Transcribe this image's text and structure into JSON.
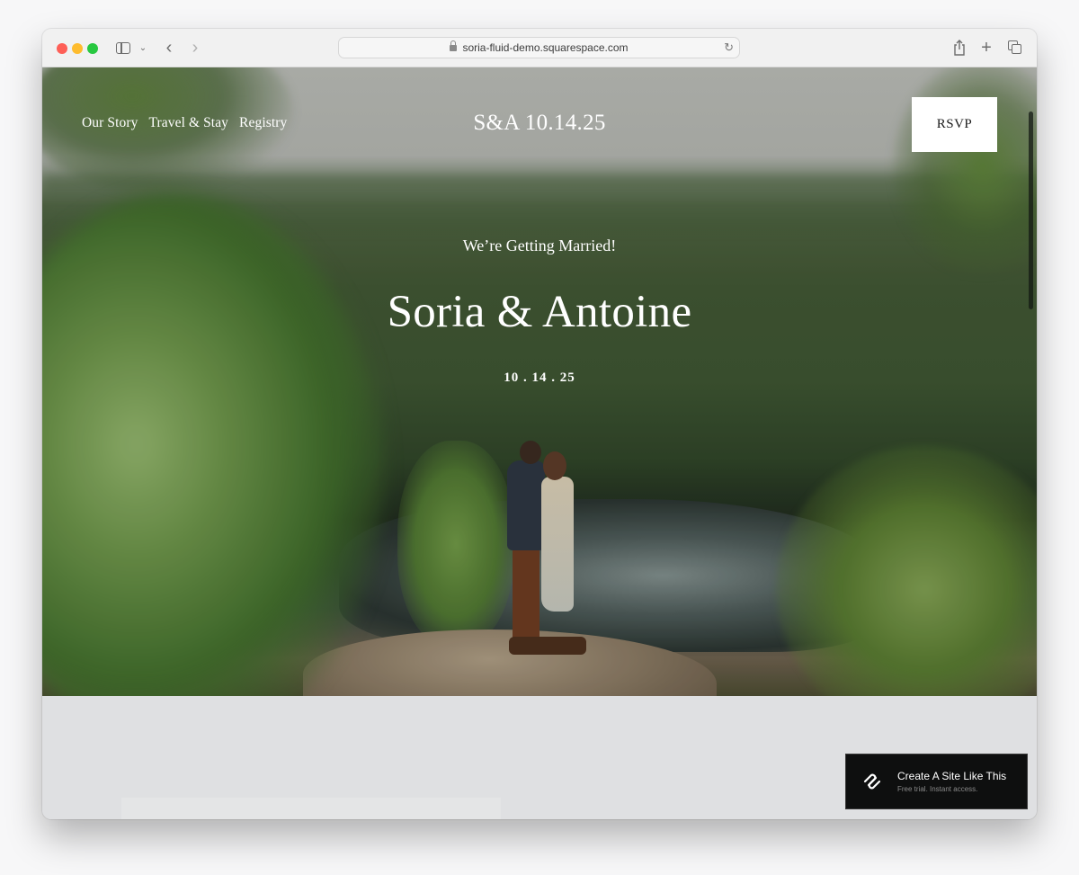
{
  "browser": {
    "url": "soria-fluid-demo.squarespace.com",
    "icons": {
      "close": "red-traffic-light",
      "minimize": "yellow-traffic-light",
      "zoom": "green-traffic-light",
      "sidebar": "sidebar-icon",
      "sidebar_menu": "chevron-down-icon",
      "back": "‹",
      "forward": "›",
      "reload": "↻",
      "share": "share-icon",
      "new_tab": "+",
      "tab_overview": "tabs-icon"
    }
  },
  "site": {
    "nav": [
      {
        "label": "Our Story"
      },
      {
        "label": "Travel & Stay"
      },
      {
        "label": "Registry"
      }
    ],
    "title": "S&A 10.14.25",
    "rsvp_label": "RSVP",
    "hero": {
      "eyebrow": "We’re Getting Married!",
      "names": "Soria & Antoine",
      "date": "10 . 14 . 25"
    }
  },
  "squarespace_badge": {
    "title": "Create A Site Like This",
    "subtitle": "Free trial. Instant access."
  },
  "colors": {
    "badge_bg": "#0e0f0f",
    "rsvp_bg": "#ffffff",
    "page_bg_below_hero": "#dfe0e2"
  }
}
